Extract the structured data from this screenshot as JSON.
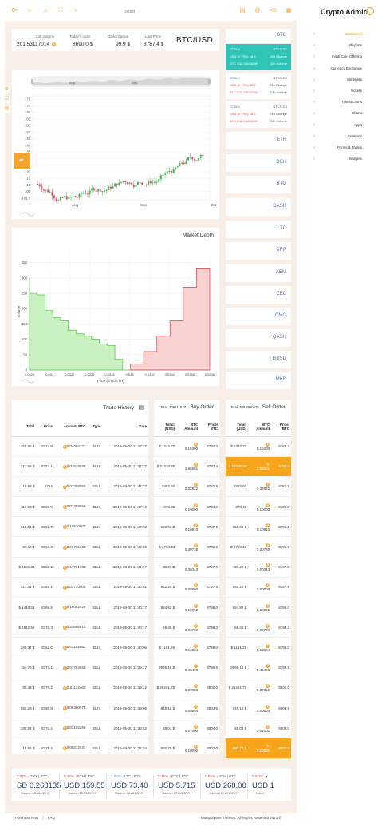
{
  "header": {
    "search_placeholder": "Search",
    "brand": "Crypto Admin",
    "left_icons": [
      "gear-icon",
      "user-icon",
      "bell-icon",
      "expand-icon",
      "search-icon"
    ],
    "right_icons": [
      "clipboard-icon",
      "at-icon",
      "chat-icon",
      "calendar-icon"
    ]
  },
  "stats": {
    "volume_24h": {
      "value": "201.53117014",
      "label": "24h volume"
    },
    "todays_open": {
      "value": "8690.0 $",
      "label": "Today's open"
    },
    "daily_change": {
      "value": "99.9 $",
      "label": "Daily change"
    },
    "last_price": {
      "value": "8787.4 $",
      "label": "Last Price"
    },
    "pair": "BTC/USD"
  },
  "candle_chart": {
    "navigator_labels": [
      "Aug",
      "Sep"
    ],
    "x_labels": [
      "Aug",
      "Sep",
      "Oct"
    ],
    "y_labels": [
      "175",
      "170",
      "165",
      "160",
      "155",
      "150",
      "145",
      "140",
      "135",
      "130",
      "125",
      "120",
      "115",
      "110",
      "105",
      "101.0"
    ]
  },
  "depth_chart": {
    "title": "Market Depth",
    "ylabel": "Volume",
    "xlabel": "Price (BTC/ETH)",
    "y_labels": [
      "350",
      "300",
      "250",
      "200",
      "150",
      "100",
      "50",
      "0"
    ],
    "x_labels": [
      "0.0328",
      "0.033",
      "0.0322",
      "0.0326",
      "0.0328",
      "0.033",
      "0.0332",
      "0.0334",
      "0.0336",
      "0.0338"
    ]
  },
  "chart_data": {
    "type": "area",
    "title": "Market Depth",
    "xlabel": "Price (BTC/ETH)",
    "ylabel": "Volume",
    "ylim": [
      0,
      350
    ],
    "series": [
      {
        "name": "",
        "color": "#8bd67a",
        "x": [
          0.0328,
          0.0329,
          0.033,
          0.0331,
          0.0332,
          0.0324,
          0.0325,
          0.0326,
          0.0327,
          0.0328,
          0.0329,
          0.033,
          0.0331,
          0.0332
        ],
        "y": [
          300,
          250,
          245,
          195,
          170,
          160,
          130,
          118,
          110,
          100,
          85,
          80,
          35,
          0
        ]
      },
      {
        "name": "",
        "color": "#f08080",
        "x": [
          0.0332,
          0.0333,
          0.0334,
          0.0335,
          0.0336,
          0.0337,
          0.0338
        ],
        "y": [
          0,
          20,
          60,
          110,
          160,
          270,
          330
        ]
      }
    ]
  },
  "coins": [
    {
      "name": "BTC",
      "active": true,
      "rows": [
        {
          "a": "B735.0",
          "b": "BTC/USD"
        },
        {
          "a": "USD (0.79%) 66.3",
          "b": "24h Change"
        },
        {
          "a": "BTC 202.13643298",
          "b": "24h Volume"
        }
      ]
    },
    {
      "name": "",
      "active": false,
      "rows": [
        {
          "a": "B735.0",
          "b": "BTC/USD"
        },
        {
          "a": "USD (0.79%) 66.3",
          "b": "24h Change"
        },
        {
          "a": "BTC 202.13643298",
          "b": "24h Volume"
        }
      ]
    },
    {
      "name": "",
      "active": false,
      "rows": [
        {
          "a": "B735.0",
          "b": "BTC/USD"
        },
        {
          "a": "USD (0.79%) 66.3",
          "b": "24h Change"
        },
        {
          "a": "BTC 202.13643298",
          "b": "24h Volume"
        }
      ]
    },
    {
      "name": "ETH"
    },
    {
      "name": "BCH"
    },
    {
      "name": "BTG"
    },
    {
      "name": "DASH"
    },
    {
      "name": "LTC"
    },
    {
      "name": "XRP"
    },
    {
      "name": "XEM"
    },
    {
      "name": "ZEC"
    },
    {
      "name": "OMG"
    },
    {
      "name": "QASH"
    },
    {
      "name": "GUSD"
    },
    {
      "name": "MKR"
    }
  ],
  "menu": [
    {
      "label": "Dashboard",
      "active": true
    },
    {
      "label": "Reports"
    },
    {
      "label": "Initial Coin Offering"
    },
    {
      "label": "Currency Exchange"
    },
    {
      "label": "Members"
    },
    {
      "label": "Tickers"
    },
    {
      "label": "Transactions"
    },
    {
      "label": "Charts"
    },
    {
      "label": "Apps"
    },
    {
      "label": "Features"
    },
    {
      "label": "Forms & Tables"
    },
    {
      "label": "Widgets"
    }
  ],
  "trade_history": {
    "title": "Trade History",
    "headers": [
      "Total",
      "Price",
      "Amount BTC",
      "Type",
      "Date"
    ],
    "rows": [
      [
        "355.66 $",
        "8772.8",
        "0.04054121",
        "BUY",
        "2019-05-30 11:47:37"
      ],
      [
        "317.66 $",
        "8753.1",
        "0.03629048",
        "BUY",
        "2019-05-30 11:47:37"
      ],
      [
        "118.93 $",
        "8754",
        "0.01358559",
        "SELL",
        "2019-05-30 11:47:37"
      ],
      [
        "119.09 $",
        "8765.9",
        "0.01358559",
        "BUY",
        "2019-05-30 11:47:12"
      ],
      [
        "919.81 $",
        "8751.7",
        "0.10510000",
        "BUY",
        "2019-05-30 11:47:12"
      ],
      [
        "67.12 $",
        "8769.4",
        "0.00765369",
        "SELL",
        "2019-05-30 11:42:58"
      ],
      [
        "$ 1552.22",
        "8769.1",
        "0.17701000",
        "SELL",
        "2019-05-30 11:41:07"
      ],
      [
        "327.44 $",
        "8769.1",
        "0.03734000",
        "SELL",
        "2019-05-30 11:40:51"
      ],
      [
        "$ 1410.23",
        "8768.9",
        "0.16082529",
        "SELL",
        "2019-05-30 11:40:17"
      ],
      [
        "$ 1812.56",
        "8770.3",
        "0.20666910",
        "SELL",
        "2019-05-30 11:40:17"
      ],
      [
        "280.37 $",
        "8782.0",
        "0.03192652",
        "BUY",
        "2019-05-30 11:40:06"
      ],
      [
        "154.76 $",
        "8770.1",
        "0.01764559",
        "SELL",
        "2019-05-30 11:39:27"
      ],
      [
        "99.33 $",
        "8770.2",
        "0.01132460",
        "SELL",
        "2019-05-30 11:39:22"
      ],
      [
        "560.29 $",
        "8780.8",
        "0.06380978",
        "BUY",
        "2019-05-30 11:39:06"
      ],
      [
        "280.02 $",
        "8770.4",
        "0.03192266",
        "SELL",
        "2019-05-30 11:35:52"
      ],
      [
        "18.65 $",
        "8775.4",
        "0.00212437",
        "SELL",
        "2019-05-30 11:32:34"
      ]
    ]
  },
  "buy_order": {
    "title": "Buy Order",
    "total_label": "Total: 4068115.01",
    "headers": [
      "Total: (USD)",
      "BTC Amount",
      "Price/ BTC"
    ],
    "rows": [
      [
        "$ 1343.70",
        "0.15300",
        "8782.3"
      ],
      [
        "$ 23418.36",
        "2.66651",
        "8782.4"
      ],
      [
        "2882.60",
        "0.32822",
        "8782.5"
      ],
      [
        "878.40",
        "0.10000",
        "8784.0"
      ],
      [
        "958.66 $",
        "0.10910",
        "8787.0"
      ],
      [
        "$ 2703.43",
        "0.30735",
        "8795.9"
      ],
      [
        "30.20 $",
        "0.00343",
        "8797.0"
      ],
      [
        "862.20 $",
        "0.09800",
        "8797.9"
      ],
      [
        "954.82 $",
        "0.10852",
        "8798.0"
      ],
      [
        "69.45 $",
        "0.00789",
        "8798.3"
      ],
      [
        "$ 1151.29",
        "0.13084",
        "8799.0"
      ],
      [
        "3995.16 $",
        "0.45400",
        "8799.9"
      ],
      [
        "$ 25261.78",
        "2.87066",
        "8800.0"
      ],
      [
        "845.18 $",
        "0.09604",
        "8803.9"
      ],
      [
        "88.04 $",
        "0.01000",
        "8804.0"
      ],
      [
        "880.70 $",
        "0.10000",
        "8807.0"
      ]
    ]
  },
  "sell_order": {
    "title": "Sell Order",
    "total_label": "Total: 409.2820238",
    "headers": [
      "Total: (USD)",
      "BTC Amount",
      "Price/ BTC"
    ],
    "highlight": [
      1,
      15
    ],
    "rows": [
      [
        "$ 1343.70",
        "0.15300",
        "8782.3"
      ],
      [
        "$ 23418.36",
        "2.66651",
        "8782.4"
      ],
      [
        "2882.60",
        "0.32822",
        "8782.5"
      ],
      [
        "878.40",
        "0.10000",
        "8784.0"
      ],
      [
        "958.66 $",
        "0.10910",
        "8795.0"
      ],
      [
        "$ 2703.43",
        "0.30735",
        "8795.9"
      ],
      [
        "30.20 $",
        "0.00343",
        "8797.0"
      ],
      [
        "862.20 $",
        "0.09800",
        "8797.9"
      ],
      [
        "954.82 $",
        "0.10852",
        "8798.0"
      ],
      [
        "69.45 $",
        "0.00789",
        "8798.3"
      ],
      [
        "$ 1151.29",
        "0.13084",
        "8799.0"
      ],
      [
        "3995.16 $",
        "0.45400",
        "8799.9"
      ],
      [
        "$ 25261.78",
        "2.87066",
        "8800.0"
      ],
      [
        "845.18 $",
        "0.09604",
        "8803.9"
      ],
      [
        "88.04 $",
        "0.01000",
        "8804.0"
      ],
      [
        "880.70 $",
        "0.10000",
        "8807.0"
      ]
    ]
  },
  "tickers": [
    {
      "pct": "2.07%",
      "pair": "ZRX | BTC",
      "price": "SD 0.268135",
      "vol": "Volume: 25,366 ZRX",
      "color": "#e04b4b"
    },
    {
      "pct": "0.47% ↑",
      "pair": "ETH | BTC",
      "price": "USD 159.55",
      "vol": "Volume: 12,334 ETH",
      "color": "#e04b4b"
    },
    {
      "pct": "1.08% ↑",
      "pair": "LTC | BTC",
      "price": "USD 73.40",
      "vol": "Volume: 34,881 BTC",
      "color": "#3aa8d8"
    },
    {
      "pct": "0.44% ↑",
      "pair": "ETC | BTC",
      "price": "USD 5.715",
      "vol": "Volume: 67,891 BTC",
      "color": "#e04b4b"
    },
    {
      "pct": "0.55% ↑",
      "pair": "BCH | BTC",
      "price": "USD 268.00",
      "vol": "Volume: 67,891 BTC",
      "color": "#e04b4b"
    },
    {
      "pct": "0.04%",
      "pair": "X",
      "price": "USD 1",
      "vol": "Volum",
      "color": "#e04b4b"
    }
  ],
  "footer": {
    "links": [
      "Purchase Now",
      "FAQ"
    ],
    "copyright": "Multipurpose Themes. All Rights Reserved 2021 ©"
  },
  "colors": {
    "accent": "#f7a42e",
    "teal": "#2ec4b6",
    "nav": "#5a6aa8"
  }
}
